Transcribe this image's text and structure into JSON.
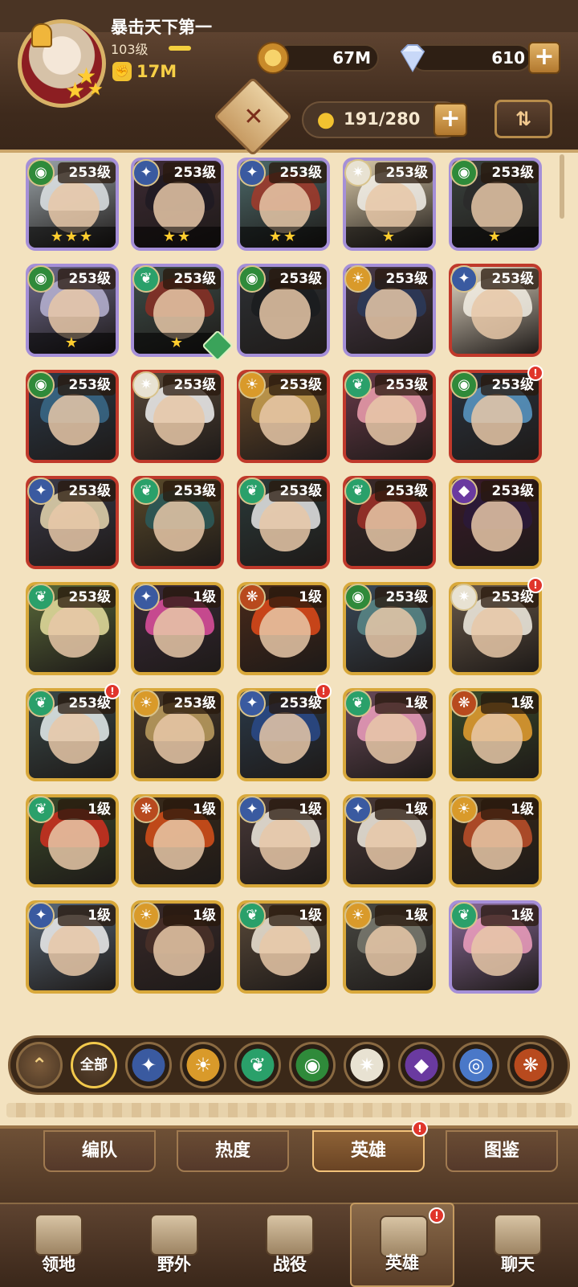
{
  "player": {
    "name": "暴击天下第一",
    "level": "103级",
    "power": "17M"
  },
  "currency": {
    "gold": "67M",
    "gems": "610"
  },
  "capacity": "191/280",
  "heroes": [
    {
      "level": "253级",
      "stars": "★★★",
      "frame": "purple",
      "faction": "green-eye",
      "bg": "#9aa3a8",
      "hair": "#dfe4e6"
    },
    {
      "level": "253级",
      "stars": "★★",
      "frame": "purple",
      "faction": "blue-star",
      "bg": "#3d2a34",
      "hair": "#1e1a22"
    },
    {
      "level": "253级",
      "stars": "★★",
      "frame": "purple",
      "faction": "blue-star",
      "bg": "#4c6a6a",
      "hair": "#a33a2a"
    },
    {
      "level": "253级",
      "stars": "★",
      "frame": "purple",
      "faction": "white-star",
      "bg": "#d9c9a8",
      "hair": "#f4f1ea"
    },
    {
      "level": "253级",
      "stars": "★",
      "frame": "purple",
      "faction": "green-eye",
      "bg": "#3b4440",
      "hair": "#2a2a2a"
    },
    {
      "level": "253级",
      "stars": "★",
      "frame": "purple",
      "faction": "green-eye",
      "bg": "#6f6a8e",
      "hair": "#b9b4d4"
    },
    {
      "level": "253级",
      "stars": "★",
      "frame": "purple",
      "faction": "green-leaf",
      "bg": "#3e4f4a",
      "hair": "#8a2f24",
      "hourglass": true
    },
    {
      "level": "253级",
      "stars": "",
      "frame": "purple",
      "faction": "green-eye",
      "bg": "#2e3236",
      "hair": "#1a1c1e"
    },
    {
      "level": "253级",
      "stars": "",
      "frame": "purple",
      "faction": "gold-sun",
      "bg": "#4a3a4a",
      "hair": "#2a3a5a"
    },
    {
      "level": "253级",
      "stars": "",
      "frame": "red",
      "faction": "blue-star",
      "bg": "#e8dcc8",
      "hair": "#f3eee4"
    },
    {
      "level": "253级",
      "stars": "",
      "frame": "red",
      "faction": "green-eye",
      "bg": "#2a3a4a",
      "hair": "#3a6a8a"
    },
    {
      "level": "253级",
      "stars": "",
      "frame": "red",
      "faction": "white-star",
      "bg": "#5a4a3a",
      "hair": "#f2f2f2"
    },
    {
      "level": "253级",
      "stars": "",
      "frame": "red",
      "faction": "gold-sun",
      "bg": "#6a4a2a",
      "hair": "#c8a050"
    },
    {
      "level": "253级",
      "stars": "",
      "frame": "red",
      "faction": "green-leaf",
      "bg": "#6a3a4a",
      "hair": "#f0a0b0"
    },
    {
      "level": "253级",
      "stars": "",
      "frame": "red",
      "faction": "green-eye",
      "bg": "#2a3440",
      "hair": "#5a9ac8",
      "alert": true
    },
    {
      "level": "253级",
      "stars": "",
      "frame": "red",
      "faction": "blue-star",
      "bg": "#3a3a4a",
      "hair": "#e8d8b0"
    },
    {
      "level": "253级",
      "stars": "",
      "frame": "red",
      "faction": "green-leaf",
      "bg": "#5a4a2a",
      "hair": "#2a5a5a"
    },
    {
      "level": "253级",
      "stars": "",
      "frame": "red",
      "faction": "green-leaf",
      "bg": "#2a3a3a",
      "hair": "#e8e8e8"
    },
    {
      "level": "253级",
      "stars": "",
      "frame": "red",
      "faction": "green-leaf",
      "bg": "#3a2a2a",
      "hair": "#a03028"
    },
    {
      "level": "253级",
      "stars": "",
      "frame": "gold",
      "faction": "purple-void",
      "bg": "#3a1a2a",
      "hair": "#2a1a3a"
    },
    {
      "level": "253级",
      "stars": "",
      "frame": "gold",
      "faction": "green-leaf",
      "bg": "#5a6a3a",
      "hair": "#e8e0a0"
    },
    {
      "level": "1级",
      "stars": "",
      "frame": "gold",
      "faction": "blue-star",
      "bg": "#3a2a3a",
      "hair": "#e050a0"
    },
    {
      "level": "1级",
      "stars": "",
      "frame": "gold",
      "faction": "red-flame",
      "bg": "#4a2a1a",
      "hair": "#e04a1a"
    },
    {
      "level": "253级",
      "stars": "",
      "frame": "gold",
      "faction": "green-eye",
      "bg": "#3a4a5a",
      "hair": "#5a8a8a"
    },
    {
      "level": "253级",
      "stars": "",
      "frame": "gold",
      "faction": "white-star",
      "bg": "#6a5a4a",
      "hair": "#f4f0e4",
      "alert": true
    },
    {
      "level": "253级",
      "stars": "",
      "frame": "gold",
      "faction": "green-leaf",
      "bg": "#3a4a4a",
      "hair": "#e8f0f0",
      "alert": true
    },
    {
      "level": "253级",
      "stars": "",
      "frame": "gold",
      "faction": "gold-sun",
      "bg": "#4a3a2a",
      "hair": "#c0a060"
    },
    {
      "level": "253级",
      "stars": "",
      "frame": "gold",
      "faction": "blue-star",
      "bg": "#2a3a4a",
      "hair": "#2a4a8a",
      "alert": true
    },
    {
      "level": "1级",
      "stars": "",
      "frame": "gold",
      "faction": "green-leaf",
      "bg": "#6a4a5a",
      "hair": "#f0a0c0"
    },
    {
      "level": "1级",
      "stars": "",
      "frame": "gold",
      "faction": "red-flame",
      "bg": "#3a4a2a",
      "hair": "#e8a030"
    },
    {
      "level": "1级",
      "stars": "",
      "frame": "gold",
      "faction": "green-leaf",
      "bg": "#3a4a2a",
      "hair": "#d03020"
    },
    {
      "level": "1级",
      "stars": "",
      "frame": "gold",
      "faction": "red-flame",
      "bg": "#3a2a1a",
      "hair": "#d8501a"
    },
    {
      "level": "1级",
      "stars": "",
      "frame": "gold",
      "faction": "blue-star",
      "bg": "#4a3a3a",
      "hair": "#f2ece0"
    },
    {
      "level": "1级",
      "stars": "",
      "frame": "gold",
      "faction": "blue-star",
      "bg": "#4a3a3a",
      "hair": "#f2ece0"
    },
    {
      "level": "1级",
      "stars": "",
      "frame": "gold",
      "faction": "gold-sun",
      "bg": "#3a2a1a",
      "hair": "#c0502a"
    },
    {
      "level": "1级",
      "stars": "",
      "frame": "gold",
      "faction": "blue-star",
      "bg": "#5a6a7a",
      "hair": "#f0f0f0"
    },
    {
      "level": "1级",
      "stars": "",
      "frame": "gold",
      "faction": "gold-sun",
      "bg": "#3a2a2a",
      "hair": "#4a3028"
    },
    {
      "level": "1级",
      "stars": "",
      "frame": "gold",
      "faction": "green-leaf",
      "bg": "#5a4a3a",
      "hair": "#f0e8d8"
    },
    {
      "level": "1级",
      "stars": "",
      "frame": "gold",
      "faction": "gold-sun",
      "bg": "#4a4a44",
      "hair": "#7a7a70"
    },
    {
      "level": "1级",
      "stars": "",
      "frame": "purple",
      "faction": "green-leaf",
      "bg": "#8a6a9a",
      "hair": "#f0a0c0"
    }
  ],
  "frame_colors": {
    "purple": "#a58fd8",
    "red": "#c0392b",
    "gold": "#d8a83a"
  },
  "faction_colors": {
    "green-eye": "#2f8a3a",
    "blue-star": "#3a5aa0",
    "white-star": "#e8e2d2",
    "green-leaf": "#2aa06a",
    "gold-sun": "#d99a2a",
    "red-flame": "#b84a1e",
    "purple-void": "#6a3aa0",
    "blue-shield": "#4a78c8"
  },
  "filters": {
    "all_label": "全部",
    "items": [
      {
        "name": "up-arrow-icon",
        "glyph": "⌃",
        "color": "#6b5238"
      },
      {
        "name": "all-filter",
        "glyph": "",
        "color": "#3a2818"
      },
      {
        "name": "blue-star-icon",
        "glyph": "✦",
        "color": "#3a5aa0"
      },
      {
        "name": "gold-sun-icon",
        "glyph": "☀",
        "color": "#d99a2a"
      },
      {
        "name": "green-leaf-icon",
        "glyph": "❦",
        "color": "#2aa06a"
      },
      {
        "name": "green-eye-icon",
        "glyph": "◉",
        "color": "#2f8a3a"
      },
      {
        "name": "white-star-icon",
        "glyph": "✷",
        "color": "#e8e2d2"
      },
      {
        "name": "purple-void-icon",
        "glyph": "◆",
        "color": "#6a3aa0"
      },
      {
        "name": "blue-shield-icon",
        "glyph": "◎",
        "color": "#4a78c8"
      },
      {
        "name": "red-flame-icon",
        "glyph": "❋",
        "color": "#b84a1e"
      }
    ]
  },
  "tabs": [
    {
      "label": "编队",
      "active": false,
      "alert": false
    },
    {
      "label": "热度",
      "active": false,
      "alert": false
    },
    {
      "label": "英雄",
      "active": true,
      "alert": true
    },
    {
      "label": "图鉴",
      "active": false,
      "alert": false
    }
  ],
  "nav": [
    {
      "label": "领地",
      "icon": "castle-icon",
      "active": false,
      "alert": false
    },
    {
      "label": "野外",
      "icon": "map-icon",
      "active": false,
      "alert": false
    },
    {
      "label": "战役",
      "icon": "sword-icon",
      "active": false,
      "alert": false
    },
    {
      "label": "英雄",
      "icon": "hero-icon",
      "active": true,
      "alert": true
    },
    {
      "label": "聊天",
      "icon": "chat-icon",
      "active": false,
      "alert": false
    }
  ]
}
